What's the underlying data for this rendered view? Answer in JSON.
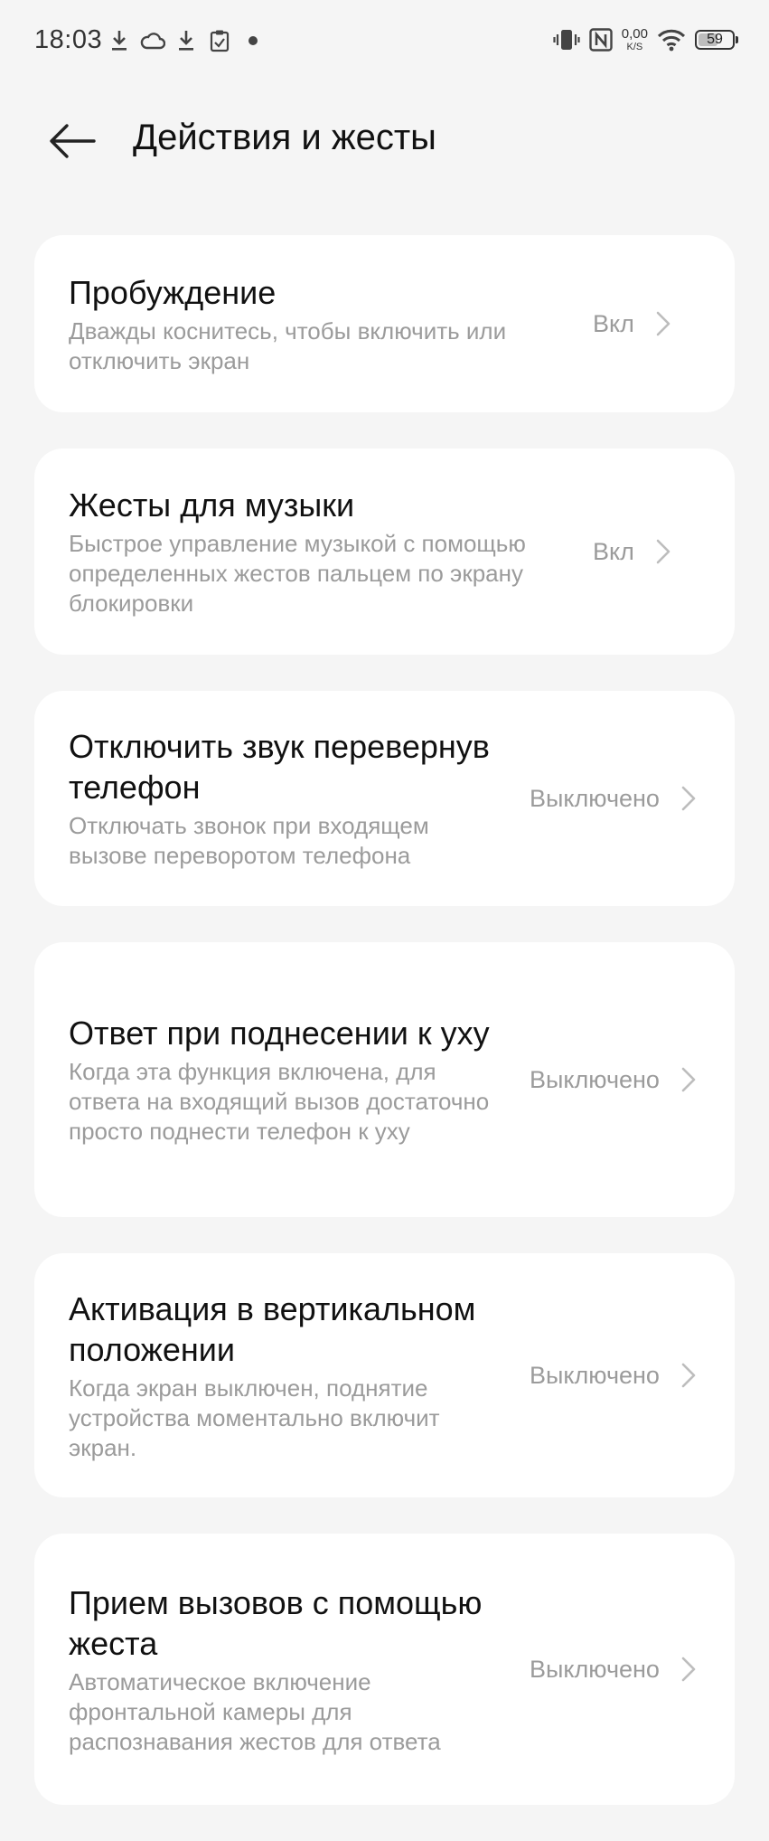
{
  "status_bar": {
    "time": "18:03",
    "net_speed_value": "0,00",
    "net_speed_unit": "K/S",
    "battery_level": "59",
    "battery_fraction": 0.59,
    "left_icons": [
      "download-icon",
      "cloud-icon",
      "download-icon",
      "clipboard-check-icon",
      "dot-icon"
    ],
    "right_icons": [
      "vibrate-icon",
      "nfc-icon",
      "net-speed",
      "wifi-icon",
      "battery-icon"
    ]
  },
  "header": {
    "back_icon": "arrow-left-icon",
    "title": "Действия и жесты"
  },
  "settings": [
    {
      "id": "wake",
      "title": "Пробуждение",
      "description": "Дважды коснитесь, чтобы включить или отключить экран",
      "status": "Вкл"
    },
    {
      "id": "music-gestures",
      "title": "Жесты для музыки",
      "description": "Быстрое управление музыкой с помощью определенных жестов пальцем по экрану блокировки",
      "status": "Вкл"
    },
    {
      "id": "flip-mute",
      "title": "Отключить звук перевернув телефон",
      "description": "Отключать звонок при входящем вызове переворотом телефона",
      "status": "Выключено"
    },
    {
      "id": "raise-to-answer",
      "title": "Ответ при поднесении к уху",
      "description": "Когда эта функция включена, для ответа на входящий вызов достаточно просто поднести телефон к уху",
      "status": "Выключено"
    },
    {
      "id": "raise-to-wake",
      "title": "Активация в вертикальном положении",
      "description": "Когда экран выключен, поднятие устройства моментально включит экран.",
      "status": "Выключено"
    },
    {
      "id": "gesture-answer",
      "title": "Прием вызовов с помощью жеста",
      "description": "Автоматическое включение фронтальной камеры для распознавания жестов для ответа",
      "status": "Выключено"
    }
  ],
  "colors": {
    "background": "#f5f5f5",
    "card": "#ffffff",
    "title_text": "#111111",
    "secondary_text": "#9b9b9b",
    "chevron": "#bdbdbd"
  }
}
